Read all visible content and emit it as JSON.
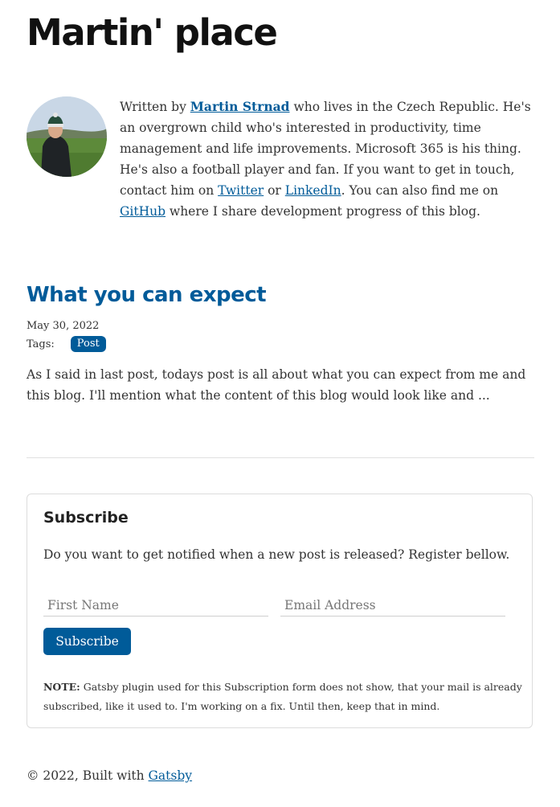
{
  "header": {
    "site_title": "Martin' place"
  },
  "bio": {
    "prefix": "Written by ",
    "author_name": "Martin Strnad",
    "text_1": " who lives in the Czech Republic. He's an overgrown child who's interested in productivity, time management and life improvements. Microsoft 365 is his thing. He's also a football player and fan. If you want to get in touch, contact him on ",
    "twitter_label": "Twitter",
    "text_2": " or ",
    "linkedin_label": "LinkedIn",
    "text_3": ". You can also find me on ",
    "github_label": "GitHub",
    "text_4": " where I share development progress of this blog."
  },
  "post": {
    "title": "What you can expect",
    "date": "May 30, 2022",
    "tags_label": "Tags:",
    "tags": [
      "Post"
    ],
    "excerpt": "As I said in last post, todays post is all about what you can expect from me and this blog. I'll mention what the content of this blog would look like and ..."
  },
  "subscribe": {
    "title": "Subscribe",
    "description": "Do you want to get notified when a new post is released? Register bellow.",
    "first_name_placeholder": "First Name",
    "email_placeholder": "Email Address",
    "button_label": "Subscribe",
    "note_label": "NOTE:",
    "note_text": " Gatsby plugin used for this Subscription form does not show, that your mail is already subscribed, like it used to. I'm working on a fix. Until then, keep that in mind."
  },
  "footer": {
    "prefix": "© 2022, Built with ",
    "link_label": "Gatsby"
  },
  "colors": {
    "accent": "#005b99",
    "title": "#111111",
    "text": "#333333"
  }
}
